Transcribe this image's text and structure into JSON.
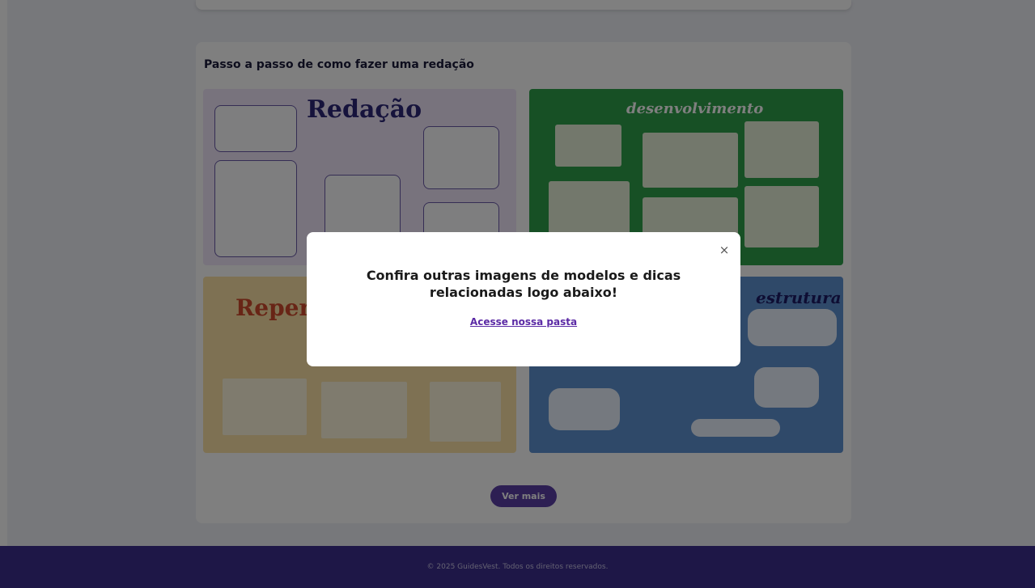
{
  "section": {
    "title": "Passo a passo de como fazer uma redação",
    "images": [
      {
        "heading": "Redação"
      },
      {
        "heading": "desenvolvimento"
      },
      {
        "heading": "Repert"
      },
      {
        "heading": "estrutura"
      }
    ],
    "more_button": "Ver mais"
  },
  "footer": {
    "copyright": "© 2025 GuidesVest. Todos os direitos reservados."
  },
  "modal": {
    "close_label": "×",
    "title": "Confira outras imagens de modelos e dicas relacionadas logo abaixo!",
    "link_text": "Acesse nossa pasta"
  },
  "colors": {
    "page_background": "#eef0f6",
    "footer_background": "#3d2f8f",
    "button_background": "#5a3ea6",
    "link_color": "#5b2aa5",
    "overlay": "rgba(0,0,0,0.5)"
  },
  "icons": [
    "close-icon"
  ]
}
